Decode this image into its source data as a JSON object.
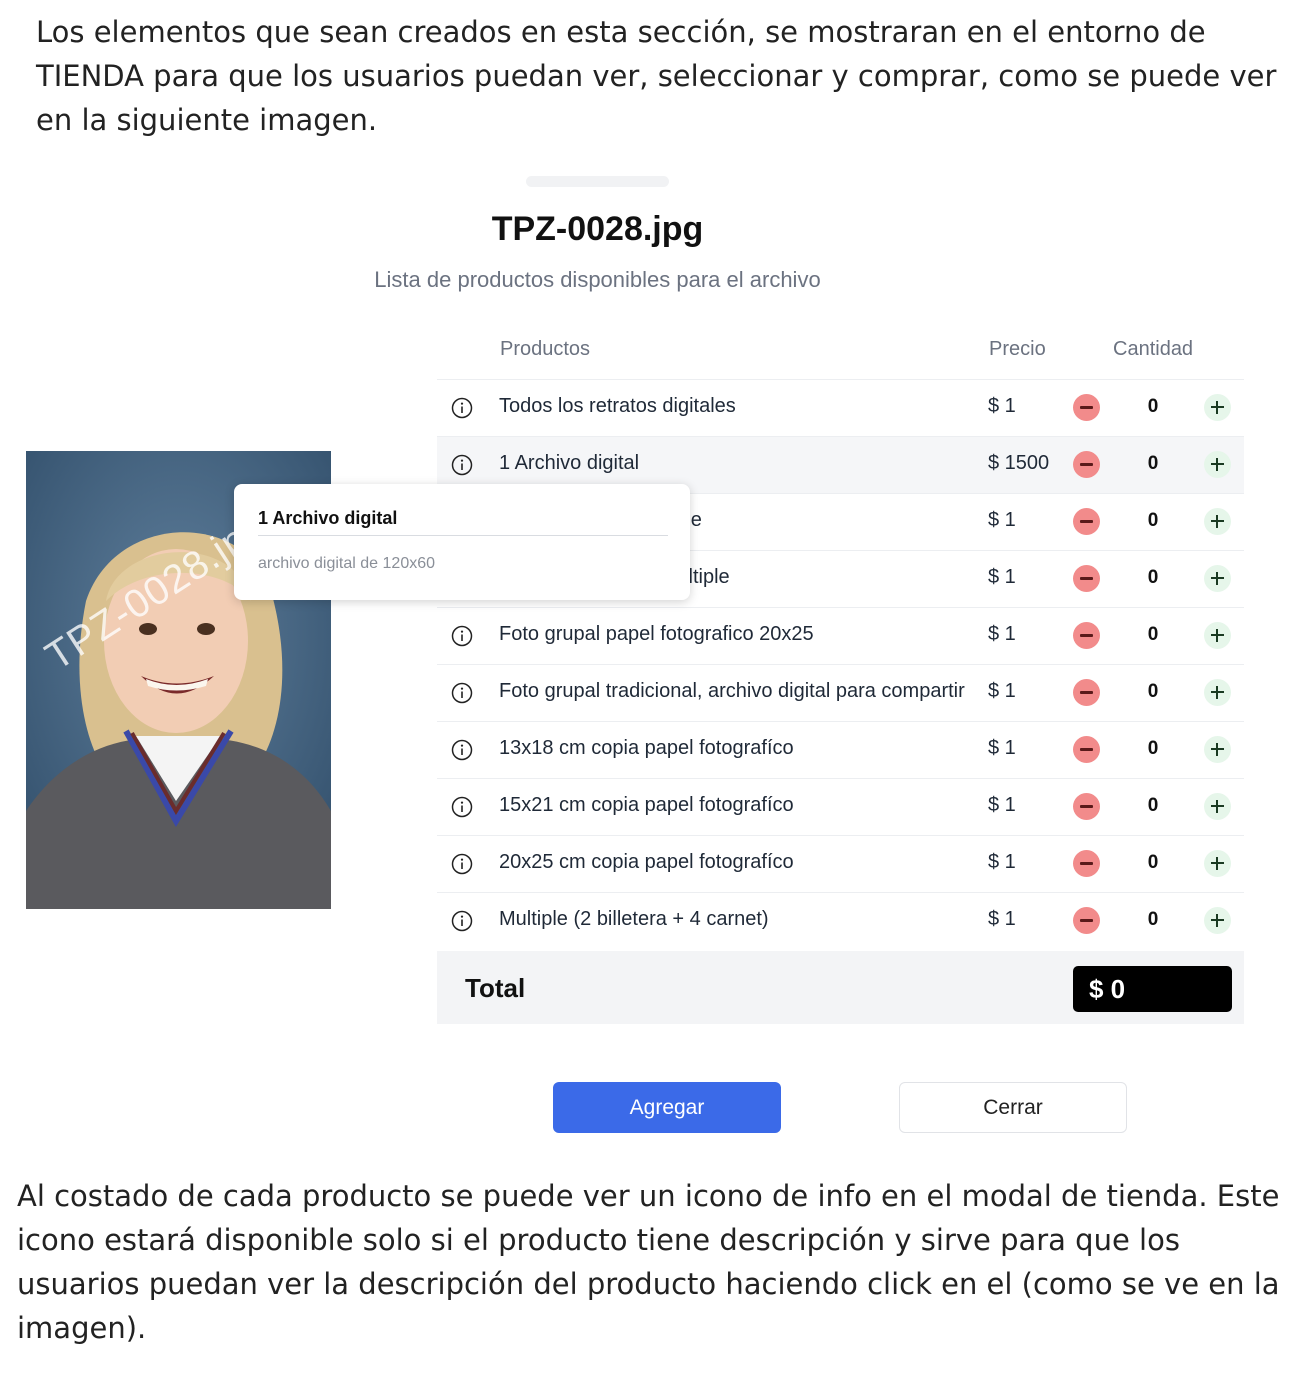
{
  "intro_text": "Los elementos que sean creados en esta sección, se mostraran en el entorno de TIENDA para que los usuarios puedan ver, seleccionar y comprar, como se puede ver en la siguiente imagen.",
  "modal": {
    "title": "TPZ-0028.jpg",
    "subtitle": "Lista de productos disponibles para el archivo",
    "photo_watermark": "TPZ-0028.jpg",
    "columns": {
      "products": "Productos",
      "price": "Precio",
      "quantity": "Cantidad"
    },
    "products": [
      {
        "name": "Todos los retratos digitales",
        "price": "$ 1",
        "qty": "0"
      },
      {
        "name": "1 Archivo digital",
        "price": "$ 1500",
        "qty": "0"
      },
      {
        "name": "grupo 20x25 + multiple",
        "price": "$ 1",
        "qty": "0"
      },
      {
        "name": "› y grupo 15x21 + multiple",
        "price": "$ 1",
        "qty": "0"
      },
      {
        "name": "Foto grupal papel fotografico 20x25",
        "price": "$ 1",
        "qty": "0"
      },
      {
        "name": "Foto grupal tradicional, archivo digital para compartir",
        "price": "$ 1",
        "qty": "0"
      },
      {
        "name": "13x18 cm copia papel fotografíco",
        "price": "$ 1",
        "qty": "0"
      },
      {
        "name": "15x21 cm copia papel fotografíco",
        "price": "$ 1",
        "qty": "0"
      },
      {
        "name": "20x25 cm copia papel fotografíco",
        "price": "$ 1",
        "qty": "0"
      },
      {
        "name": "Multiple (2 billetera + 4 carnet)",
        "price": "$ 1",
        "qty": "0"
      }
    ],
    "total_label": "Total",
    "total_value": "$ 0",
    "add_button": "Agregar",
    "close_button": "Cerrar",
    "tooltip": {
      "title": "1 Archivo digital",
      "description": "archivo digital de 120x60"
    }
  },
  "outro_text": "Al costado de cada producto se puede ver un icono de info en el modal de tienda. Este icono estará disponible solo si el producto tiene descripción y sirve para que los usuarios puedan ver la descripción del producto haciendo click en el (como se ve en la imagen).",
  "colors": {
    "primary_button": "#3b6ae8",
    "minus_button": "#f28b8b",
    "plus_button": "#e6f6ea",
    "total_badge": "#000000"
  }
}
